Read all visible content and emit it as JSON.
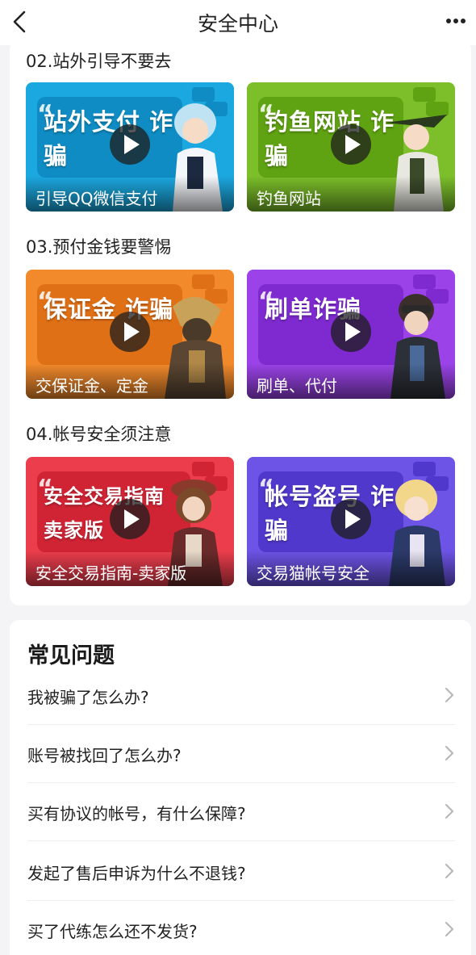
{
  "nav": {
    "title": "安全中心",
    "back_icon": "chevron-left-icon",
    "more_icon": "more-dots-icon"
  },
  "sections": [
    {
      "title": "02.站外引导不要去",
      "videos": [
        {
          "big_text": "站外支付 诈骗",
          "caption": "引导QQ微信支付",
          "bg": "#1ba8e0",
          "accent": "#0f8cc4"
        },
        {
          "big_text": "钓鱼网站 诈骗",
          "caption": "钓鱼网站",
          "bg": "#7cbf2a",
          "accent": "#5fa212"
        }
      ]
    },
    {
      "title": "03.预付金钱要警惕",
      "videos": [
        {
          "big_text": "保证金 诈骗",
          "caption": "交保证金、定金",
          "bg": "#f28a2c",
          "accent": "#e07016"
        },
        {
          "big_text": "刷单诈骗",
          "caption": "刷单、代付",
          "bg": "#9b43e8",
          "accent": "#7e2ad0"
        }
      ]
    },
    {
      "title": "04.帐号安全须注意",
      "videos": [
        {
          "big_text": "安全交易指南 卖家版",
          "caption": "安全交易指南-卖家版",
          "bg": "#ec3d4c",
          "accent": "#d02434"
        },
        {
          "big_text": "帐号盗号 诈骗",
          "caption": "交易猫帐号安全",
          "bg": "#6d54e6",
          "accent": "#5138cc"
        }
      ]
    }
  ],
  "faq": {
    "title": "常见问题",
    "items": [
      "我被骗了怎么办?",
      "账号被找回了怎么办?",
      "买有协议的帐号，有什么保障?",
      "发起了售后申诉为什么不退钱?",
      "买了代练怎么还不发货?"
    ]
  }
}
